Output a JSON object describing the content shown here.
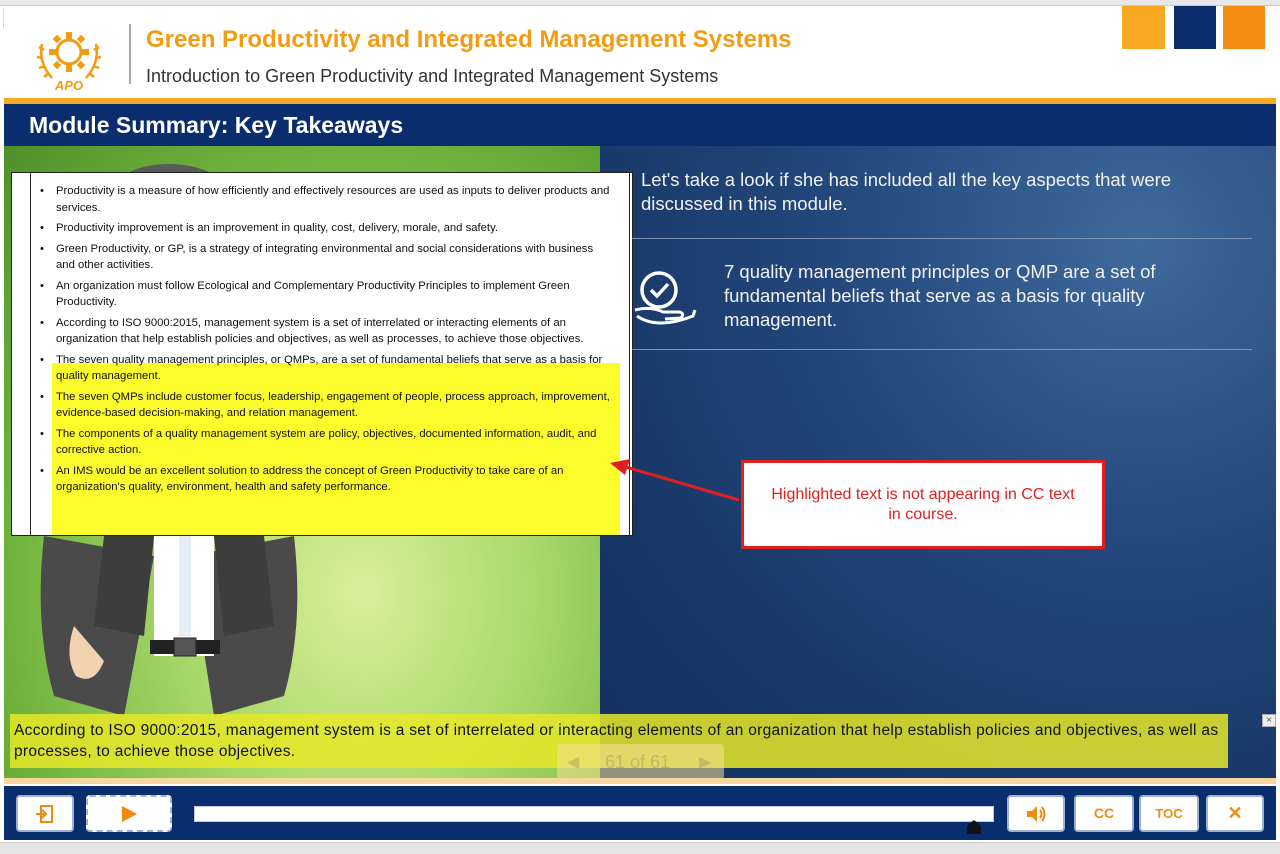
{
  "header": {
    "expand_glyph": "»",
    "course_title": "Green Productivity and Integrated Management Systems",
    "course_subtitle": "Introduction to Green Productivity and Integrated Management Systems",
    "logo_text": "APO"
  },
  "module": {
    "title": "Module Summary: Key Takeaways"
  },
  "document": {
    "bullet_glyph": "•",
    "items": [
      "Productivity is a measure of how efficiently and effectively resources are used as inputs to deliver products and services.",
      "Productivity improvement is an improvement in quality, cost, delivery, morale, and safety.",
      "Green Productivity, or GP, is a strategy of integrating environmental and social considerations with business and other activities.",
      "An organization must follow Ecological and Complementary Productivity Principles to implement Green Productivity.",
      "According to ISO 9000:2015, management system is a set of interrelated or interacting elements of an organization that help establish policies and objectives, as well as processes, to achieve those objectives.",
      "The seven quality management principles, or QMPs, are a set of fundamental beliefs that serve as a basis for quality management.",
      "The seven QMPs include customer focus, leadership, engagement of people, process approach, improvement, evidence-based decision-making, and relation management.",
      "The components of a quality management system are policy, objectives, documented information, audit, and corrective action.",
      "An IMS would be an excellent solution to address the concept of Green Productivity to take care of an organization's quality, environment, health and safety performance."
    ]
  },
  "right": {
    "intro": "Let's take a look if she has included all the key aspects that were discussed in this module.",
    "qmp_icon": "hand-check-icon",
    "qmp_text": "7 quality management principles or QMP are a set of fundamental beliefs that serve as a basis for quality management."
  },
  "annotation": {
    "text": "Highlighted text is not appearing in CC text in course.",
    "color": "#e02020"
  },
  "caption": {
    "text": "According to ISO 9000:2015, management system is a set of interrelated or interacting elements of an organization that help establish policies and objectives, as well as processes, to achieve those objectives.",
    "close_glyph": "×"
  },
  "pager": {
    "prev_glyph": "◀",
    "label": "61 of 61",
    "next_glyph": "▶"
  },
  "controls": {
    "exit_icon": "exit-icon",
    "play_icon": "play-icon",
    "volume_icon": "volume-icon",
    "cc_label": "CC",
    "toc_label": "TOC",
    "close_label": "✕",
    "progress": 0.975
  },
  "colors": {
    "brand_orange": "#f39c12",
    "brand_navy": "#0a2d6e",
    "highlight_yellow": "#fcfc2c"
  }
}
